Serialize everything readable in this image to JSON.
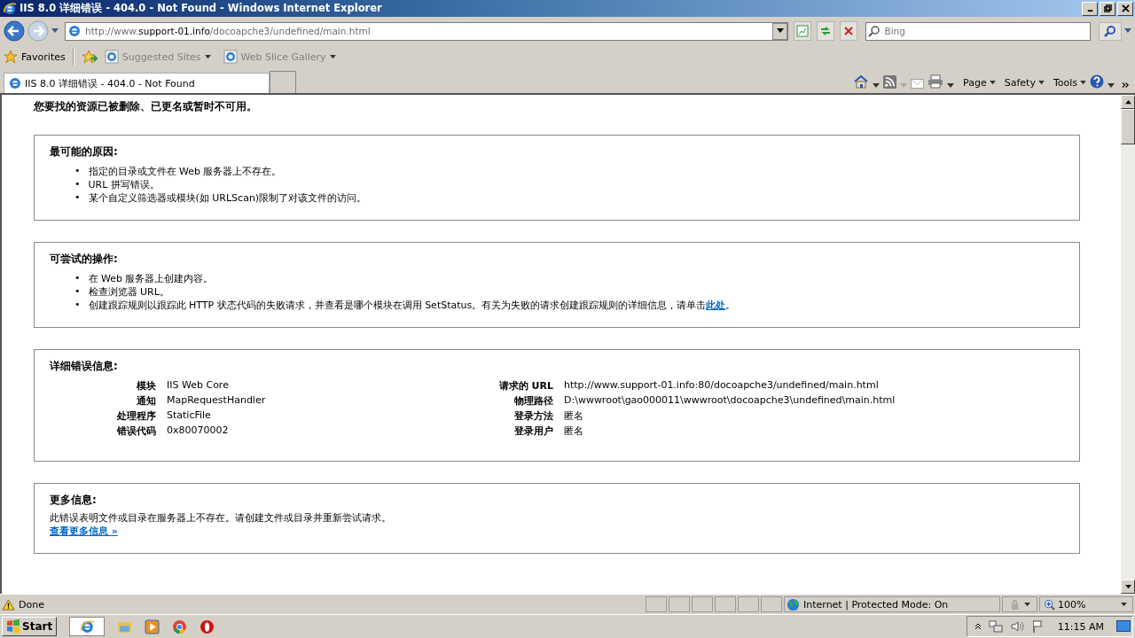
{
  "window": {
    "title": "IIS 8.0 详细错误 - 404.0 - Not Found - Windows Internet Explorer"
  },
  "address_bar": {
    "url_prefix": "http://www.",
    "url_host": "support-01.info",
    "url_path": "/docoapche3/undefined/main.html"
  },
  "search": {
    "placeholder": "Bing"
  },
  "favorites_bar": {
    "label": "Favorites",
    "items": [
      "Suggested Sites",
      "Web Slice Gallery"
    ]
  },
  "tabs": [
    {
      "label": "IIS 8.0 详细错误 - 404.0 - Not Found",
      "selected": true
    }
  ],
  "command_bar": [
    "Page",
    "Safety",
    "Tools"
  ],
  "page": {
    "heading": "您要找的资源已被删除、已更名或暂时不可用。",
    "sections": [
      {
        "kind": "list",
        "title": "最可能的原因:",
        "items": [
          {
            "bullet": "•",
            "text": "指定的目录或文件在 Web 服务器上不存在。"
          },
          {
            "bullet": "•",
            "text": "URL 拼写错误。"
          },
          {
            "bullet": "•",
            "text": "某个自定义筛选器或模块(如 URLScan)限制了对该文件的访问。"
          }
        ]
      },
      {
        "kind": "list",
        "title": "可尝试的操作:",
        "items": [
          {
            "bullet": "•",
            "text": "在 Web 服务器上创建内容。"
          },
          {
            "bullet": "•",
            "text": "检查浏览器 URL。"
          },
          {
            "bullet": "•",
            "text": "创建跟踪规则以跟踪此 HTTP 状态代码的失败请求，并查看是哪个模块在调用 SetStatus。有关为失败的请求创建跟踪规则的详细信息，请单击",
            "link": "此处",
            "after": "。"
          }
        ]
      },
      {
        "kind": "details",
        "title": "详细错误信息:",
        "left": [
          {
            "label": "模块",
            "value": "IIS Web Core"
          },
          {
            "label": "通知",
            "value": "MapRequestHandler"
          },
          {
            "label": "处理程序",
            "value": "StaticFile"
          },
          {
            "label": "错误代码",
            "value": "0x80070002"
          }
        ],
        "right": [
          {
            "label": "请求的 URL",
            "value": "http://www.support-01.info:80/docoapche3/undefined/main.html"
          },
          {
            "label": "物理路径",
            "value": "D:\\wwwroot\\gao000011\\wwwroot\\docoapche3\\undefined\\main.html"
          },
          {
            "label": "登录方法",
            "value": "匿名"
          },
          {
            "label": "登录用户",
            "value": "匿名"
          }
        ]
      },
      {
        "kind": "text",
        "title": "更多信息:",
        "text": "此错误表明文件或目录在服务器上不存在。请创建文件或目录并重新尝试请求。",
        "link": "查看更多信息 »"
      }
    ]
  },
  "status_bar": {
    "status": "Done",
    "zone": "Internet | Protected Mode: On",
    "zoom": "100%"
  },
  "taskbar": {
    "start": "Start",
    "clock": "11:15 AM"
  }
}
